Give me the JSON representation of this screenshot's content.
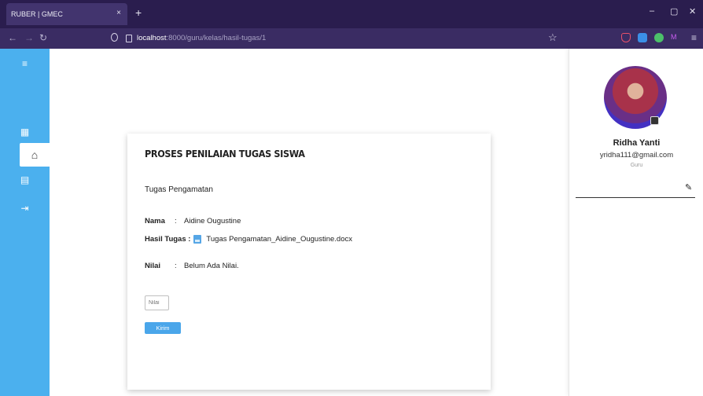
{
  "browser": {
    "tab_title": "RUBER | GMEC",
    "tab_close": "×",
    "new_tab": "+",
    "url_host": "localhost",
    "url_path": ":8000/guru/kelas/hasil-tugas/1",
    "icons": [
      "back-arrow-icon",
      "forward-arrow-icon",
      "reload-icon",
      "shield-icon",
      "page-icon",
      "bookmark-star-icon",
      "pocket-icon",
      "extension-icon",
      "menu-icon"
    ]
  },
  "sidebar": {
    "items": [
      {
        "icon": "hamburger-menu-icon",
        "glyph": "≡"
      },
      {
        "icon": "dashboard-grid-icon",
        "glyph": "▦"
      },
      {
        "icon": "home-icon",
        "glyph": "⌂"
      },
      {
        "icon": "document-icon",
        "glyph": "▤"
      },
      {
        "icon": "logout-icon",
        "glyph": "⇥"
      }
    ]
  },
  "main": {
    "title": "PROSES PENILAIAN TUGAS SISWA",
    "subtitle": "Tugas Pengamatan",
    "nama_label": "Nama",
    "nama_sep": ":",
    "nama_value": "Aidine Ougustine",
    "hasil_label": "Hasil Tugas :",
    "hasil_file": "Tugas Pengamatan_Aidine_Ougustine.docx",
    "nilai_label": "Nilai",
    "nilai_sep": ":",
    "nilai_value": "Belum Ada Nilai.",
    "nilai_placeholder": "Nilai",
    "submit_label": "Kirim"
  },
  "profile": {
    "name": "Ridha Yanti",
    "email": "yridha111@gmail.com",
    "role": "Guru"
  },
  "colors": {
    "sidebar": "#4bb0ee",
    "button": "#4aa6ea",
    "browser_chrome": "#2a1d4e"
  }
}
